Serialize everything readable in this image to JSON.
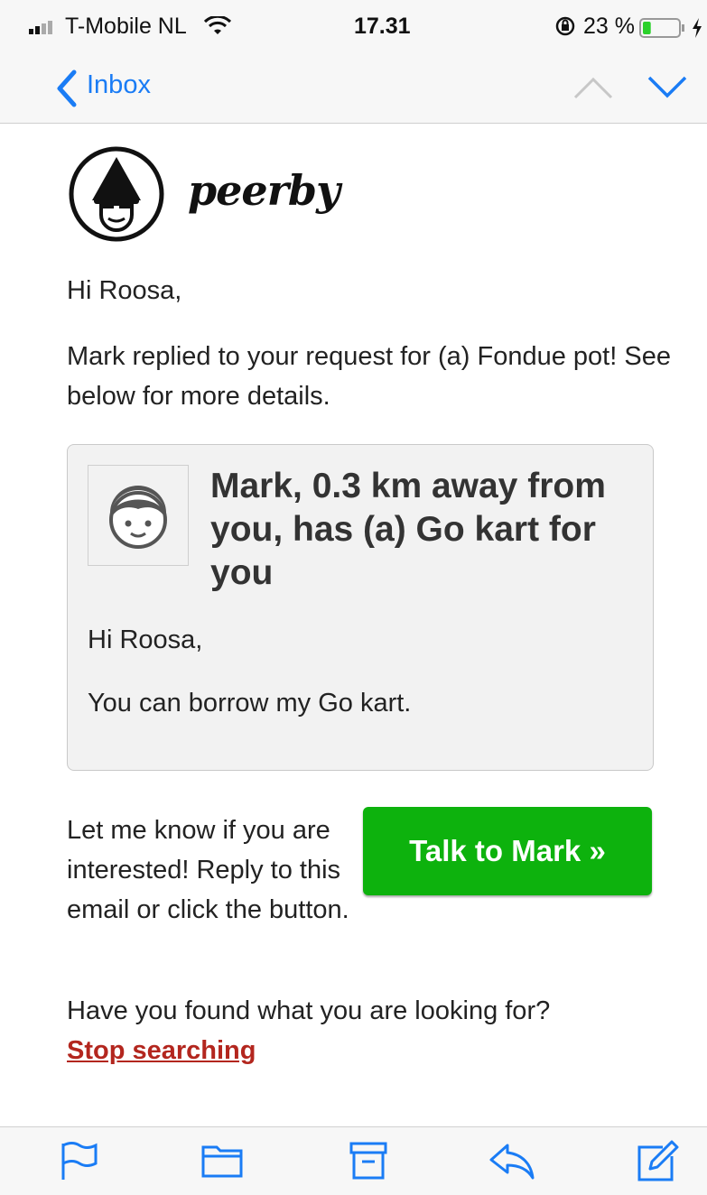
{
  "status_bar": {
    "carrier": "T-Mobile NL",
    "time": "17.31",
    "battery_percent": "23 %",
    "battery_level": 0.23
  },
  "nav": {
    "back_label": "Inbox"
  },
  "logo": {
    "text": "peerby"
  },
  "email": {
    "greeting": "Hi Roosa,",
    "intro": "Mark replied to your request for (a) Fondue pot! See below for more details.",
    "card": {
      "title": "Mark, 0.3 km away from you, has (a) Go kart for you",
      "greeting": "Hi Roosa,",
      "message": "You can borrow my Go kart."
    },
    "cta_text": "Let me know if you are interested! Reply to this email or click the button.",
    "cta_button": "Talk to Mark »",
    "found_text": "Have you found what you are looking for?",
    "stop_link": "Stop searching"
  },
  "colors": {
    "accent_blue": "#1a7cf5",
    "button_green": "#0db20d",
    "link_red": "#b3261e"
  },
  "toolbar": {
    "icons": [
      "flag-icon",
      "folder-icon",
      "archive-icon",
      "reply-icon",
      "compose-icon"
    ]
  }
}
